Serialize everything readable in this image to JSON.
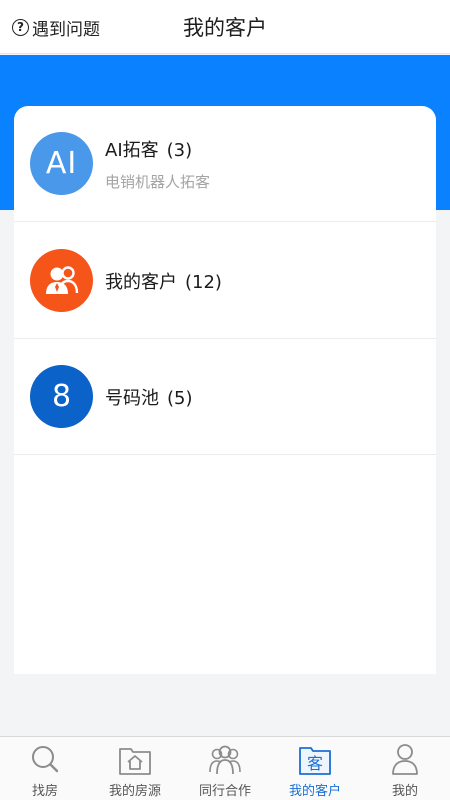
{
  "header": {
    "help_icon_glyph": "?",
    "help_label": "遇到问题",
    "title": "我的客户"
  },
  "colors": {
    "banner": "#0a82ff",
    "ai_avatar": "#4a98ea",
    "customer_avatar": "#f6551a",
    "pool_avatar": "#0b62c9",
    "active_tab": "#1a6fd6"
  },
  "list": {
    "items": [
      {
        "icon": "ai-icon",
        "avatar_text": "AI",
        "title": "AI拓客",
        "count": "(3)",
        "subtitle": "电销机器人拓客"
      },
      {
        "icon": "customer-group-icon",
        "title": "我的客户",
        "count": "(12)"
      },
      {
        "icon": "number-8-icon",
        "avatar_text": "8",
        "title": "号码池",
        "count": "(5)"
      }
    ]
  },
  "tabbar": {
    "tabs": [
      {
        "icon": "search-icon",
        "label": "找房",
        "active": false
      },
      {
        "icon": "house-folder-icon",
        "label": "我的房源",
        "active": false
      },
      {
        "icon": "people-icon",
        "label": "同行合作",
        "active": false
      },
      {
        "icon": "customer-folder-icon",
        "icon_text": "客",
        "label": "我的客户",
        "active": true
      },
      {
        "icon": "user-icon",
        "label": "我的",
        "active": false
      }
    ]
  }
}
